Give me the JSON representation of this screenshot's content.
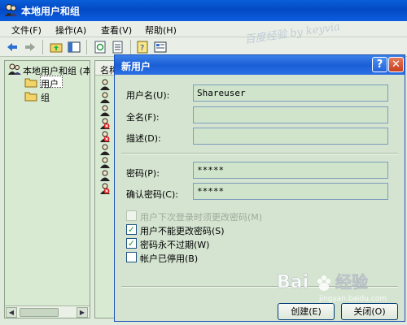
{
  "main_window": {
    "title": "本地用户和组",
    "menu": [
      "文件(F)",
      "操作(A)",
      "查看(V)",
      "帮助(H)"
    ]
  },
  "tree": {
    "root_label": "本地用户和组 (本",
    "items": [
      "用户",
      "组"
    ]
  },
  "list": {
    "column_header": "名称"
  },
  "dialog": {
    "title": "新用户",
    "help_glyph": "?",
    "close_glyph": "✕",
    "fields": {
      "username_label": "用户名(U):",
      "username_value": "Shareuser",
      "fullname_label": "全名(F):",
      "fullname_value": "",
      "description_label": "描述(D):",
      "description_value": "",
      "password_label": "密码(P):",
      "password_value": "*****",
      "confirm_label": "确认密码(C):",
      "confirm_value": "*****"
    },
    "checkboxes": [
      {
        "label": "用户下次登录时须更改密码(M)",
        "checked": false,
        "enabled": false
      },
      {
        "label": "用户不能更改密码(S)",
        "checked": true,
        "enabled": true
      },
      {
        "label": "密码永不过期(W)",
        "checked": true,
        "enabled": true
      },
      {
        "label": "帐户已停用(B)",
        "checked": false,
        "enabled": true
      }
    ],
    "buttons": {
      "create": "创建(E)",
      "close": "关闭(O)"
    }
  },
  "watermark": {
    "top_text": "百度经验 by keyvia",
    "bottom_text": "Bai 经验",
    "bottom_sub": "jingyan.baidu.com"
  },
  "colors": {
    "title_blue": "#0349c4",
    "window_bg": "#d4e4d0",
    "input_bg": "#cfe4cb",
    "check_green": "#21a121"
  }
}
